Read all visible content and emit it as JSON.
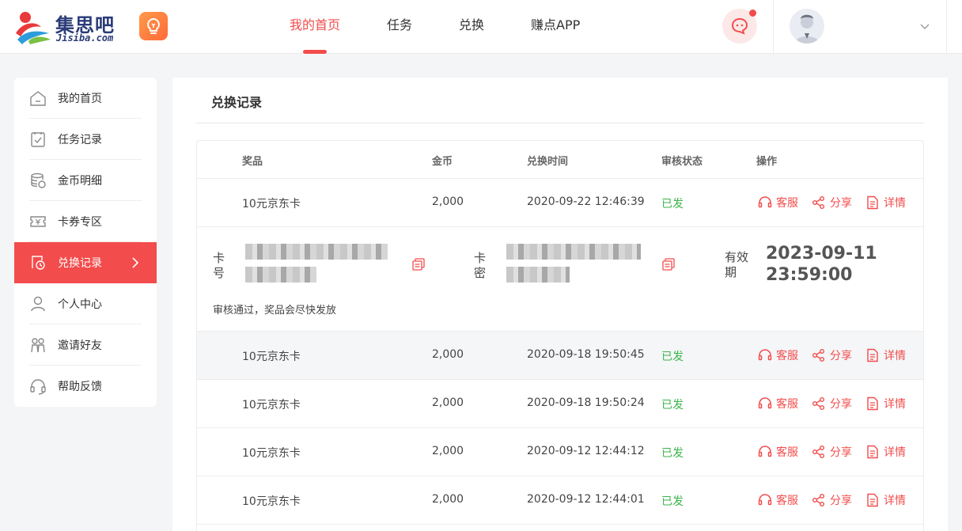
{
  "header": {
    "logo_cn": "集思吧",
    "logo_en": "Jisiba.com",
    "nav": [
      "我的首页",
      "任务",
      "兑换",
      "赚点APP"
    ],
    "nav_active": 0
  },
  "sidebar": {
    "items": [
      {
        "label": "我的首页",
        "icon": "home-icon"
      },
      {
        "label": "任务记录",
        "icon": "clipboard-icon"
      },
      {
        "label": "金币明细",
        "icon": "coins-icon"
      },
      {
        "label": "卡券专区",
        "icon": "ticket-icon"
      },
      {
        "label": "兑换记录",
        "icon": "exchange-record-icon",
        "active": true
      },
      {
        "label": "个人中心",
        "icon": "user-icon"
      },
      {
        "label": "邀请好友",
        "icon": "friends-icon"
      },
      {
        "label": "帮助反馈",
        "icon": "headset-icon"
      }
    ]
  },
  "main": {
    "title": "兑换记录",
    "columns": [
      "奖品",
      "金币",
      "兑换时间",
      "审核状态",
      "操作"
    ],
    "actions": [
      "客服",
      "分享",
      "详情"
    ],
    "rows": [
      {
        "prize": "10元京东卡",
        "coins": "2,000",
        "time": "2020-09-22 12:46:39",
        "status": "已发"
      },
      {
        "prize": "10元京东卡",
        "coins": "2,000",
        "time": "2020-09-18 19:50:45",
        "status": "已发"
      },
      {
        "prize": "10元京东卡",
        "coins": "2,000",
        "time": "2020-09-18 19:50:24",
        "status": "已发"
      },
      {
        "prize": "10元京东卡",
        "coins": "2,000",
        "time": "2020-09-12 12:44:12",
        "status": "已发"
      },
      {
        "prize": "10元京东卡",
        "coins": "2,000",
        "time": "2020-09-12 12:44:01",
        "status": "已发"
      }
    ],
    "detail": {
      "card_no_label": "卡号",
      "card_pwd_label": "卡密",
      "expire_label": "有效期",
      "expire_value": "2023-09-11 23:59:00",
      "note": "审核通过，奖品会尽快发放"
    }
  },
  "colors": {
    "accent": "#f34c4c",
    "success": "#3bb44a",
    "brand": "#2a3b78"
  }
}
